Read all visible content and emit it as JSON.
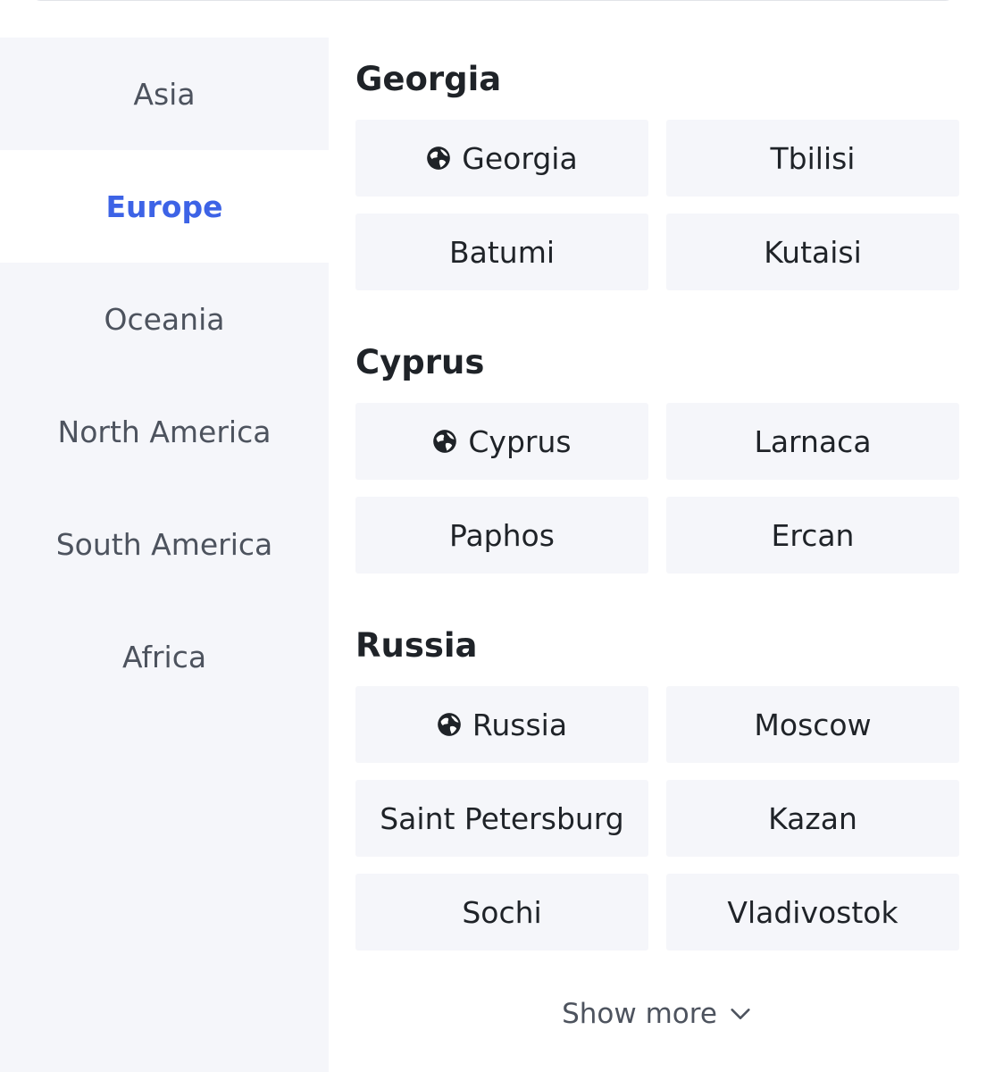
{
  "sidebar": {
    "regions": [
      {
        "label": "Asia",
        "active": false
      },
      {
        "label": "Europe",
        "active": true
      },
      {
        "label": "Oceania",
        "active": false
      },
      {
        "label": "North America",
        "active": false
      },
      {
        "label": "South America",
        "active": false
      },
      {
        "label": "Africa",
        "active": false
      }
    ]
  },
  "countries": [
    {
      "title": "Georgia",
      "chips": [
        {
          "label": "Georgia",
          "icon": "globe-icon"
        },
        {
          "label": "Tbilisi"
        },
        {
          "label": "Batumi"
        },
        {
          "label": "Kutaisi"
        }
      ]
    },
    {
      "title": "Cyprus",
      "chips": [
        {
          "label": "Cyprus",
          "icon": "globe-icon"
        },
        {
          "label": "Larnaca"
        },
        {
          "label": "Paphos"
        },
        {
          "label": "Ercan"
        }
      ]
    },
    {
      "title": "Russia",
      "chips": [
        {
          "label": "Russia",
          "icon": "globe-icon"
        },
        {
          "label": "Moscow"
        },
        {
          "label": "Saint Petersburg"
        },
        {
          "label": "Kazan"
        },
        {
          "label": "Sochi"
        },
        {
          "label": "Vladivostok"
        }
      ]
    }
  ],
  "show_more": {
    "label": "Show more",
    "icon": "chevron-down-icon"
  },
  "colors": {
    "accent": "#3d63e6",
    "sidebar_bg": "#f5f6fa",
    "chip_bg": "#f5f6fa",
    "text": "#1f2328",
    "muted": "#4d535e"
  }
}
